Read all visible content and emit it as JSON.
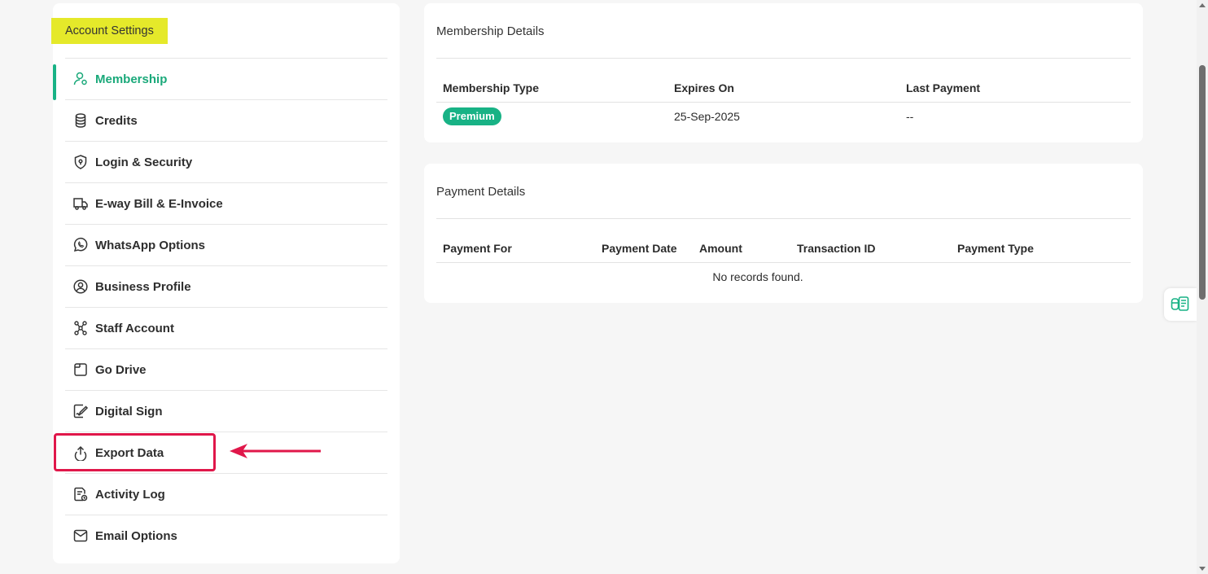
{
  "sidebar": {
    "title": "Account Settings",
    "items": [
      {
        "label": "Membership",
        "icon": "user-membership-icon",
        "active": true
      },
      {
        "label": "Credits",
        "icon": "coins-icon"
      },
      {
        "label": "Login & Security",
        "icon": "shield-icon"
      },
      {
        "label": "E-way Bill & E-Invoice",
        "icon": "truck-icon"
      },
      {
        "label": "WhatsApp Options",
        "icon": "whatsapp-icon"
      },
      {
        "label": "Business Profile",
        "icon": "user-circle-icon"
      },
      {
        "label": "Staff Account",
        "icon": "staff-network-icon"
      },
      {
        "label": "Go Drive",
        "icon": "folder-icon"
      },
      {
        "label": "Digital Sign",
        "icon": "signature-icon"
      },
      {
        "label": "Export Data",
        "icon": "upload-icon"
      },
      {
        "label": "Activity Log",
        "icon": "log-file-icon"
      },
      {
        "label": "Email Options",
        "icon": "mail-icon"
      }
    ]
  },
  "membership": {
    "title": "Membership Details",
    "headers": {
      "type": "Membership Type",
      "expires": "Expires On",
      "last_payment": "Last Payment"
    },
    "row": {
      "type": "Premium",
      "expires": "25-Sep-2025",
      "last_payment": "--"
    }
  },
  "payment": {
    "title": "Payment Details",
    "headers": {
      "for": "Payment For",
      "date": "Payment Date",
      "amount": "Amount",
      "txn": "Transaction ID",
      "ptype": "Payment Type"
    },
    "empty": "No records found."
  },
  "colors": {
    "accent": "#18b285",
    "highlight": "#e5e92a",
    "annotation": "#e0174a"
  }
}
